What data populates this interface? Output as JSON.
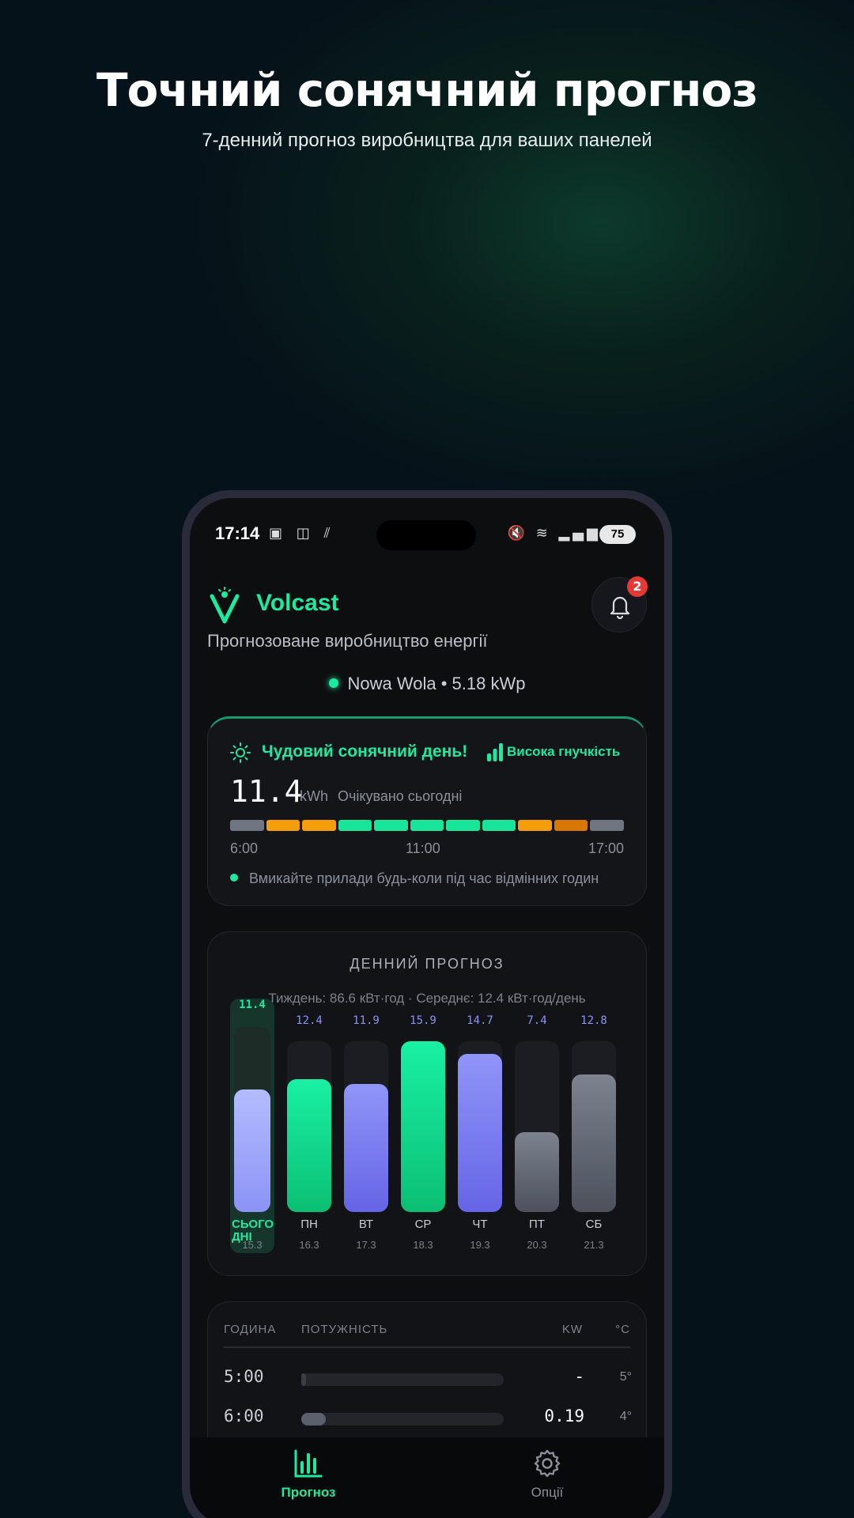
{
  "promo": {
    "title": "Точний сонячний прогноз",
    "subtitle": "7-денний прогноз виробництва для ваших панелей"
  },
  "status_bar": {
    "time": "17:14",
    "battery": "75"
  },
  "app": {
    "name": "Volcast",
    "subtitle": "Прогнозоване виробництво енергії",
    "notification_count": "2",
    "location": "Nowa Wola • 5.18 kWp"
  },
  "today": {
    "title": "Чудовий сонячний день!",
    "flexibility": "Висока гнучкість",
    "value": "11.4",
    "unit": "kWh",
    "expected_label": "Очікувано сьогодні",
    "timeline_colors": [
      "#6f7682",
      "#f59e0b",
      "#f59e0b",
      "#19e59a",
      "#19e59a",
      "#19e59a",
      "#19e59a",
      "#19e59a",
      "#f59e0b",
      "#d97706",
      "#6f7682"
    ],
    "time_start": "6:00",
    "time_mid": "11:00",
    "time_end": "17:00",
    "tip": "Вмикайте прилади будь-коли під час відмінних годин"
  },
  "forecast": {
    "title": "ДЕННИЙ ПРОГНОЗ",
    "summary": "Тиждень: 86.6 кВт·год · Середнє: 12.4 кВт·год/день",
    "scale_max": 15.9,
    "days": [
      {
        "name": "СЬОГОДНІ",
        "date": "15.3",
        "value": "11.4",
        "kwh": 11.4,
        "today": true,
        "color": "lavender"
      },
      {
        "name": "ПН",
        "date": "16.3",
        "value": "12.4",
        "kwh": 12.4,
        "today": false,
        "color": "green"
      },
      {
        "name": "ВТ",
        "date": "17.3",
        "value": "11.9",
        "kwh": 11.9,
        "today": false,
        "color": "purple"
      },
      {
        "name": "СР",
        "date": "18.3",
        "value": "15.9",
        "kwh": 15.9,
        "today": false,
        "color": "green"
      },
      {
        "name": "ЧТ",
        "date": "19.3",
        "value": "14.7",
        "kwh": 14.7,
        "today": false,
        "color": "purple"
      },
      {
        "name": "ПТ",
        "date": "20.3",
        "value": "7.4",
        "kwh": 7.4,
        "today": false,
        "color": "gray"
      },
      {
        "name": "СБ",
        "date": "21.3",
        "value": "12.8",
        "kwh": 12.8,
        "today": false,
        "color": "gray"
      }
    ],
    "colors": {
      "lavender": [
        "#b4bcff",
        "#8b93f5"
      ],
      "green": [
        "#19f0a3",
        "#0bbf74"
      ],
      "purple": [
        "#8f95f8",
        "#6565e6"
      ],
      "gray": [
        "#7c828e",
        "#4c515c"
      ]
    },
    "value_colors": {
      "today": "#1de9a0",
      "other": "#8c93f3"
    }
  },
  "hourly": {
    "col_hour": "ГОДИНА",
    "col_power": "ПОТУЖНІСТЬ",
    "col_kw": "KW",
    "col_temp": "°C",
    "rows": [
      {
        "time": "5:00",
        "kw": "-",
        "temp": "5°",
        "level": 0.0
      },
      {
        "time": "6:00",
        "kw": "0.19",
        "temp": "4°",
        "level": 0.12
      }
    ]
  },
  "nav": {
    "forecast_label": "Прогноз",
    "options_label": "Опції",
    "active_color": "#1de9a0",
    "inactive_color": "#8a909a"
  }
}
